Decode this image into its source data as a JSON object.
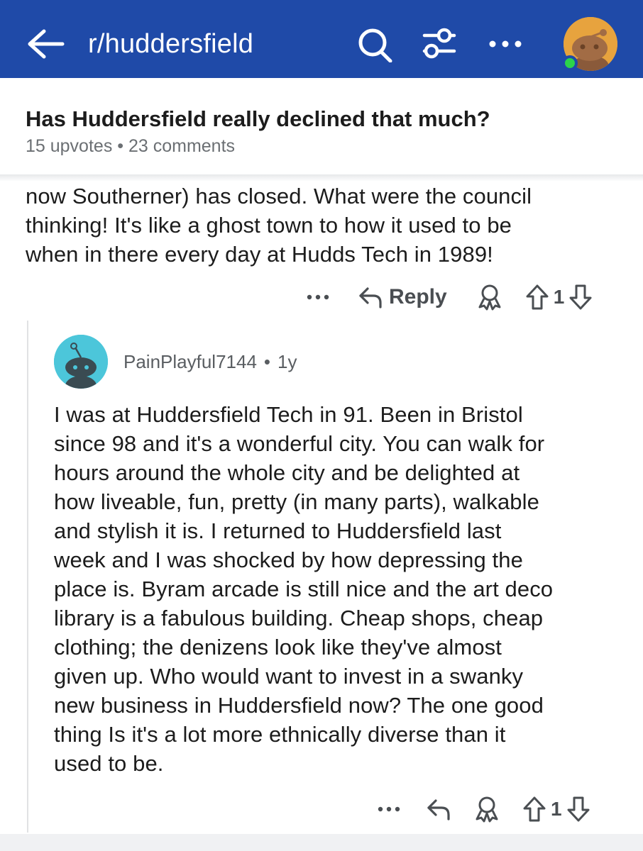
{
  "header": {
    "subreddit": "r/huddersfield",
    "colors": {
      "bar": "#1f4aa8",
      "online": "#2bd44a"
    },
    "icons": [
      "back-arrow-icon",
      "search-icon",
      "filter-icon",
      "more-icon",
      "avatar-icon"
    ]
  },
  "post": {
    "title": "Has Huddersfield really declined that much?",
    "meta": "15 upvotes • 23 comments"
  },
  "comment1": {
    "lines": [
      "now Southerner) has closed. What were the council",
      "thinking! It's like a ghost town to how it used to be",
      "when in there every day at Hudds Tech in 1989!"
    ],
    "actions": {
      "more": "•••",
      "reply": "Reply",
      "votes": "1"
    }
  },
  "comment2": {
    "author": "PainPlayful7144",
    "separator": "•",
    "age": "1y",
    "lines": [
      "I was at Huddersfield Tech in 91. Been in Bristol",
      "since 98 and it's a wonderful city. You can walk for",
      "hours around the whole city and be delighted at",
      "how liveable, fun, pretty (in many parts), walkable",
      "and stylish it is. I returned to Huddersfield last",
      "week and I was shocked by how depressing the",
      "place is. Byram arcade is still nice and the art deco",
      "library is a fabulous building. Cheap shops, cheap",
      "clothing; the denizens look like they've almost",
      "given up. Who would want to invest in a swanky",
      "new business in Huddersfield now? The one good",
      "thing Is it's a lot more ethnically diverse than it",
      "used to be."
    ],
    "actions": {
      "more": "•••",
      "votes": "1"
    }
  }
}
